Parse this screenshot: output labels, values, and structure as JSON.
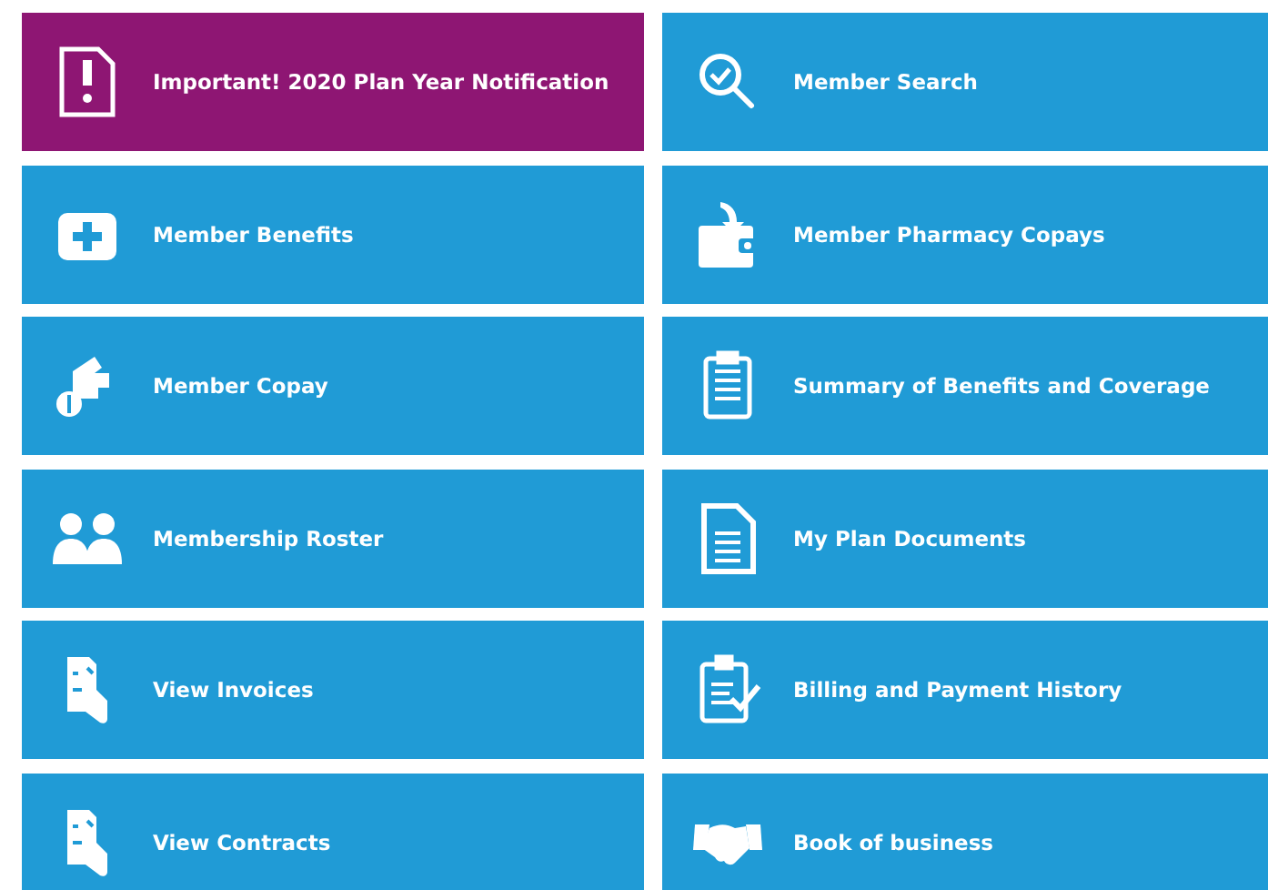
{
  "tiles": [
    {
      "label": "Important! 2020 Plan Year Notification",
      "color": "#8e1673"
    },
    {
      "label": "Member Search",
      "color": "#209bd6"
    },
    {
      "label": "Member Benefits",
      "color": "#209bd6"
    },
    {
      "label": "Member Pharmacy Copays",
      "color": "#209bd6"
    },
    {
      "label": "Member Copay",
      "color": "#209bd6"
    },
    {
      "label": "Summary of Benefits and Coverage",
      "color": "#209bd6"
    },
    {
      "label": "Membership Roster",
      "color": "#209bd6"
    },
    {
      "label": "My Plan Documents",
      "color": "#209bd6"
    },
    {
      "label": "View Invoices",
      "color": "#209bd6"
    },
    {
      "label": "Billing and Payment History",
      "color": "#209bd6"
    },
    {
      "label": "View Contracts",
      "color": "#209bd6"
    },
    {
      "label": "Book of business",
      "color": "#209bd6"
    }
  ]
}
